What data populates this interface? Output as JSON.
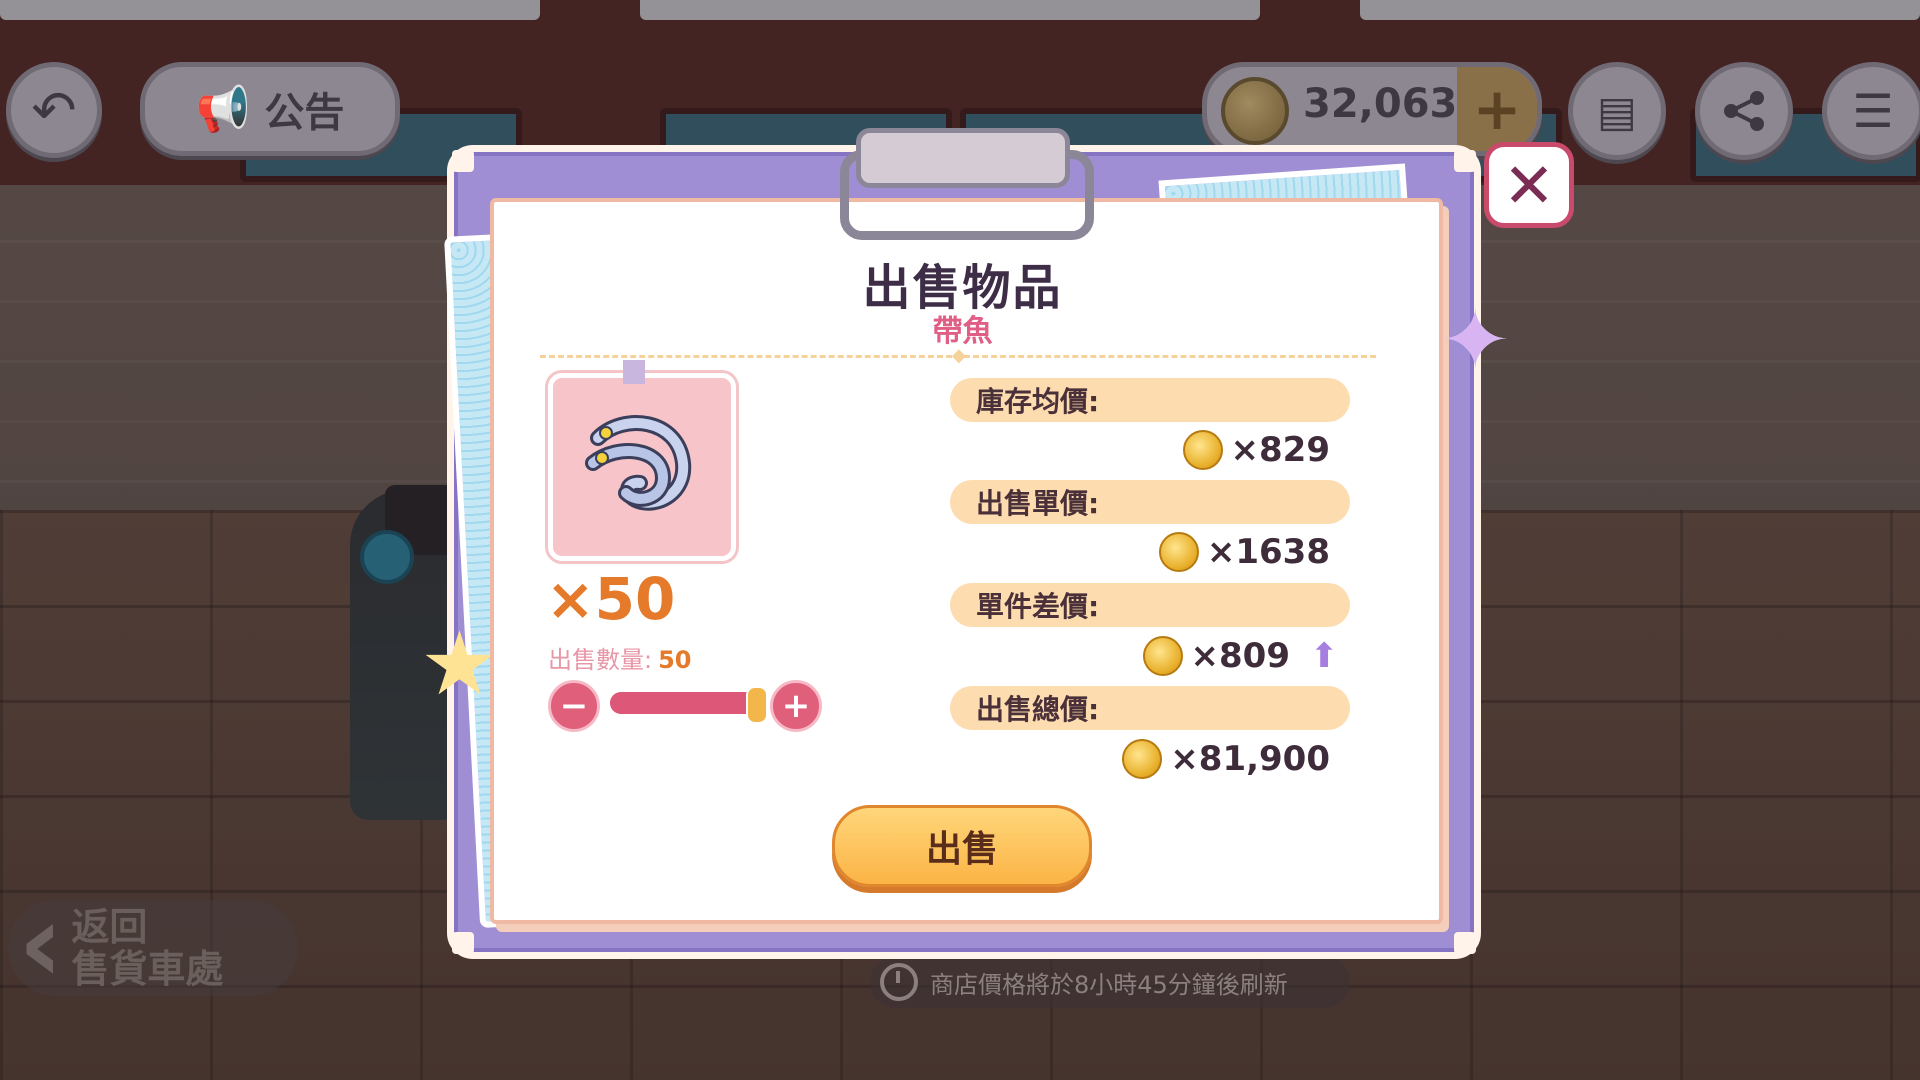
{
  "hud": {
    "notice_label": "公告",
    "coins": "32,063",
    "coin_add": "+"
  },
  "icons": {
    "back": "back-arrow-icon",
    "notice": "megaphone-icon",
    "coin": "coin-icon",
    "document": "document-icon",
    "share": "share-icon",
    "menu": "menu-icon",
    "close": "close-icon"
  },
  "dialog": {
    "title": "出售物品",
    "item_name": "帶魚",
    "quantity_display": "×50",
    "quantity_label": "出售數量:",
    "quantity_value": "50",
    "quantity_fill_fraction": 1.0,
    "rows": [
      {
        "label": "庫存均價:",
        "value": "×829"
      },
      {
        "label": "出售單價:",
        "value": "×1638"
      },
      {
        "label": "單件差價:",
        "value": "×809"
      },
      {
        "label": "出售總價:",
        "value": "×81,900"
      }
    ],
    "sell_button": "出售",
    "minus": "−",
    "plus": "+"
  },
  "footer": {
    "return_line1": "返回",
    "return_line2": "售貨車處",
    "refresh_text": "商店價格將於8小時45分鐘後刷新"
  },
  "colors": {
    "frame": "#a08ed4",
    "accent_pink": "#e05f86",
    "accent_orange": "#e57a2a",
    "row_bg": "#fddcb0",
    "sell_button": "#fbb446"
  }
}
